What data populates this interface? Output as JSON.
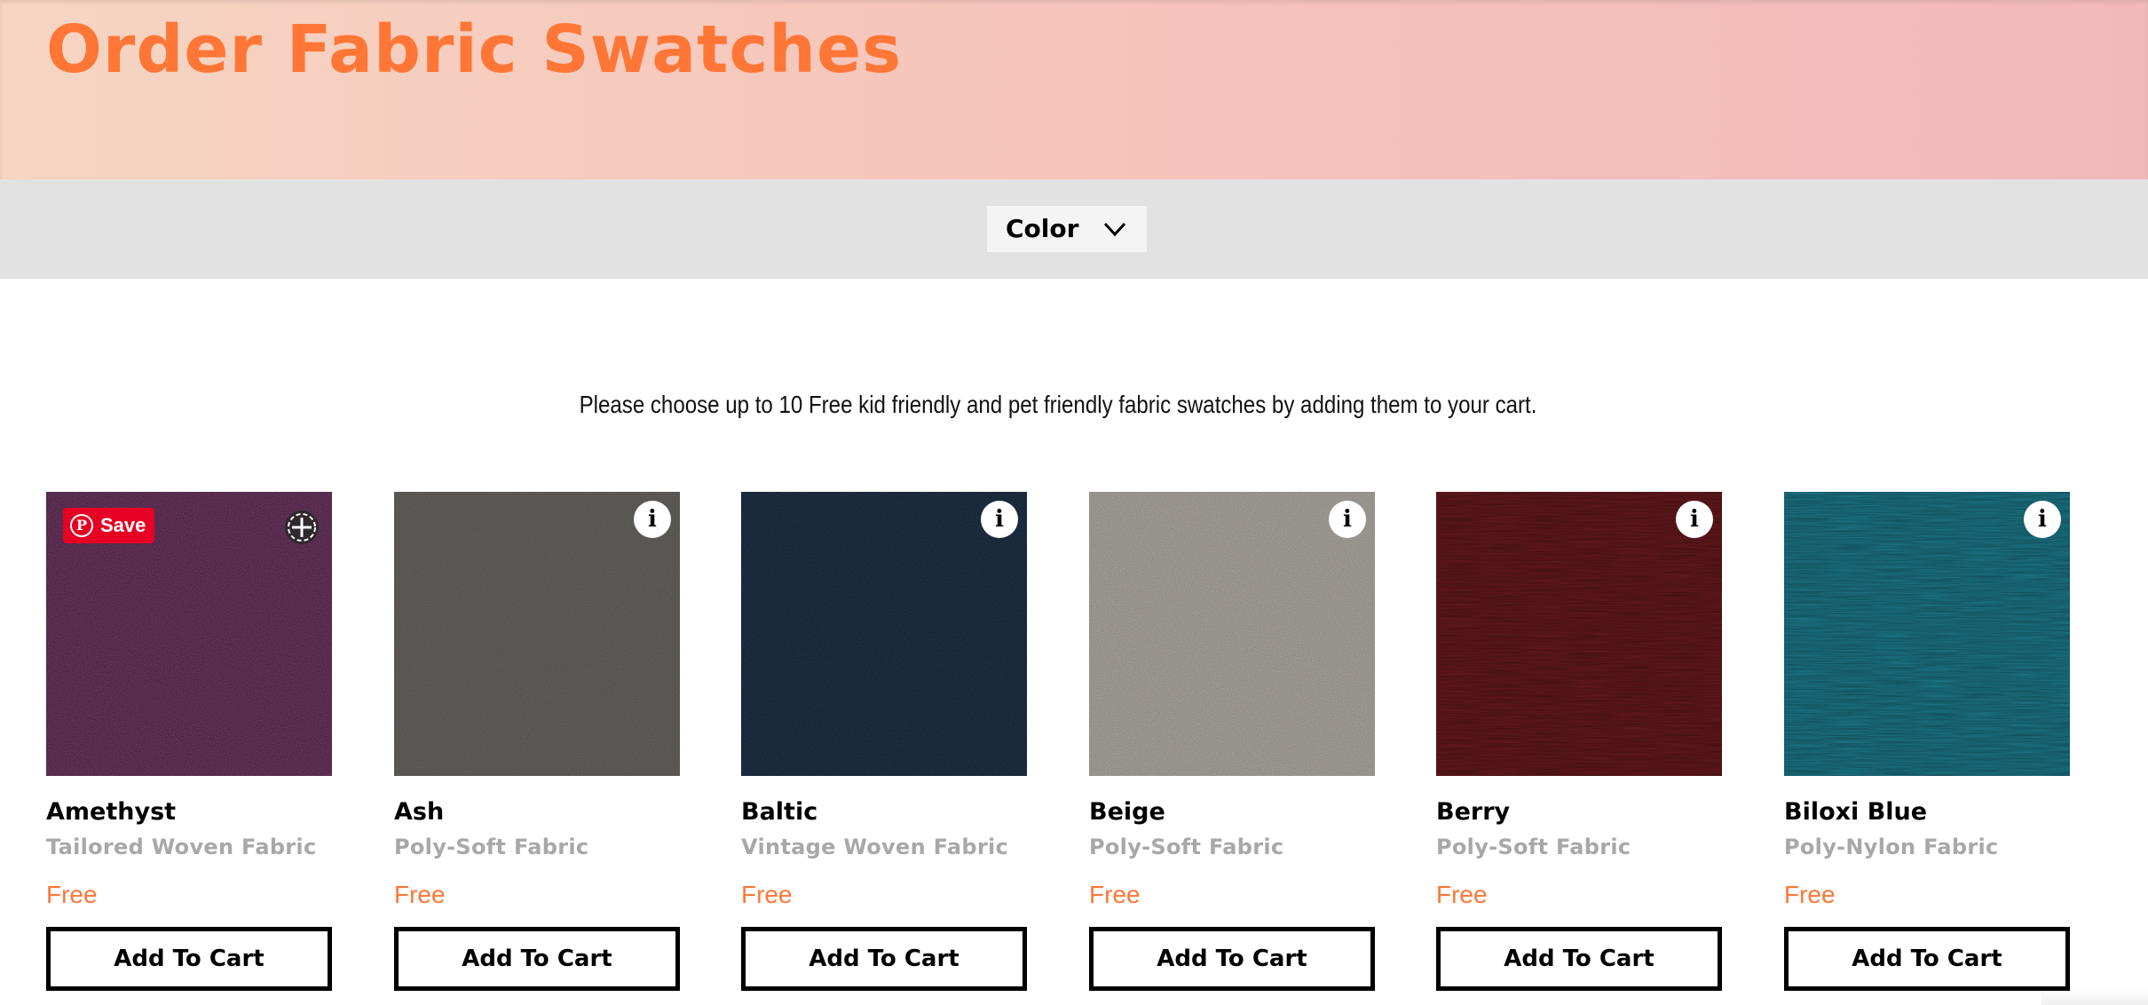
{
  "hero": {
    "title": "Order Fabric Swatches"
  },
  "filter": {
    "color_label": "Color",
    "icon": "chevron-down-icon"
  },
  "intro": {
    "text": "Please choose up to 10 Free kid friendly and pet friendly fabric swatches by adding them to your cart."
  },
  "colors": {
    "accent": "#ff7636",
    "pinterest": "#e60023",
    "filter_bar": "#e2e2e2",
    "muted_text": "#a8a8a8"
  },
  "pinterest": {
    "save_label": "Save",
    "icon": "pinterest-icon"
  },
  "info_icon": "i",
  "swatches": [
    {
      "name": "Amethyst",
      "fabric": "Tailored Woven Fabric",
      "price": "Free",
      "button": "Add To Cart",
      "color": "#7a3d6e"
    },
    {
      "name": "Ash",
      "fabric": "Poly-Soft Fabric",
      "price": "Free",
      "button": "Add To Cart",
      "color": "#6f6c69"
    },
    {
      "name": "Baltic",
      "fabric": "Vintage Woven Fabric",
      "price": "Free",
      "button": "Add To Cart",
      "color": "#243954"
    },
    {
      "name": "Beige",
      "fabric": "Poly-Soft Fabric",
      "price": "Free",
      "button": "Add To Cart",
      "color": "#bdb7b0"
    },
    {
      "name": "Berry",
      "fabric": "Poly-Soft Fabric",
      "price": "Free",
      "button": "Add To Cart",
      "color": "#6b1a1e"
    },
    {
      "name": "Biloxi Blue",
      "fabric": "Poly-Nylon Fabric",
      "price": "Free",
      "button": "Add To Cart",
      "color": "#1d7d8f"
    }
  ]
}
